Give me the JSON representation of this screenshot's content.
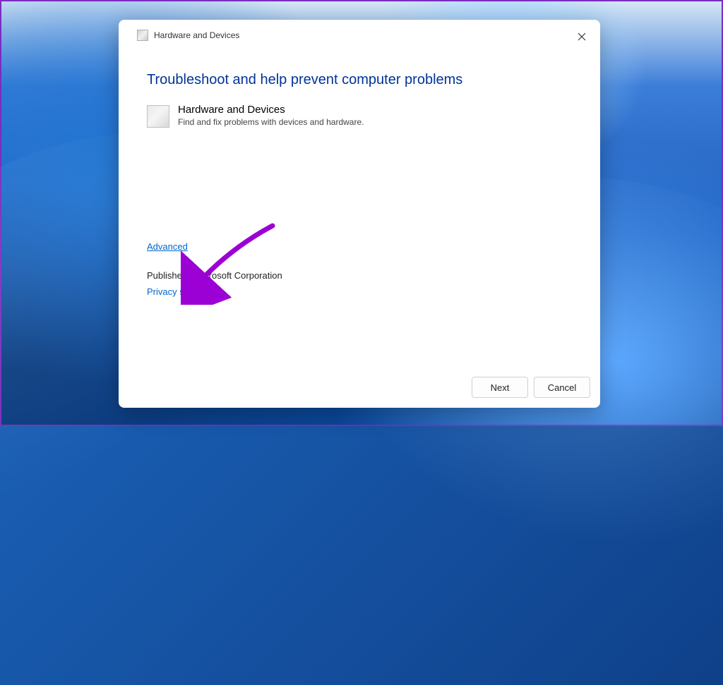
{
  "dialog": {
    "header_title": "Hardware and Devices",
    "main_heading": "Troubleshoot and help prevent computer problems",
    "troubleshooter": {
      "title": "Hardware and Devices",
      "description": "Find and fix problems with devices and hardware."
    },
    "advanced_link": "Advanced",
    "publisher_label": "Publisher:",
    "publisher_value": "Microsoft Corporation",
    "privacy_link": "Privacy statement",
    "buttons": {
      "next": "Next",
      "cancel": "Cancel"
    }
  },
  "annotation": {
    "arrow_color": "#9b00d4"
  }
}
